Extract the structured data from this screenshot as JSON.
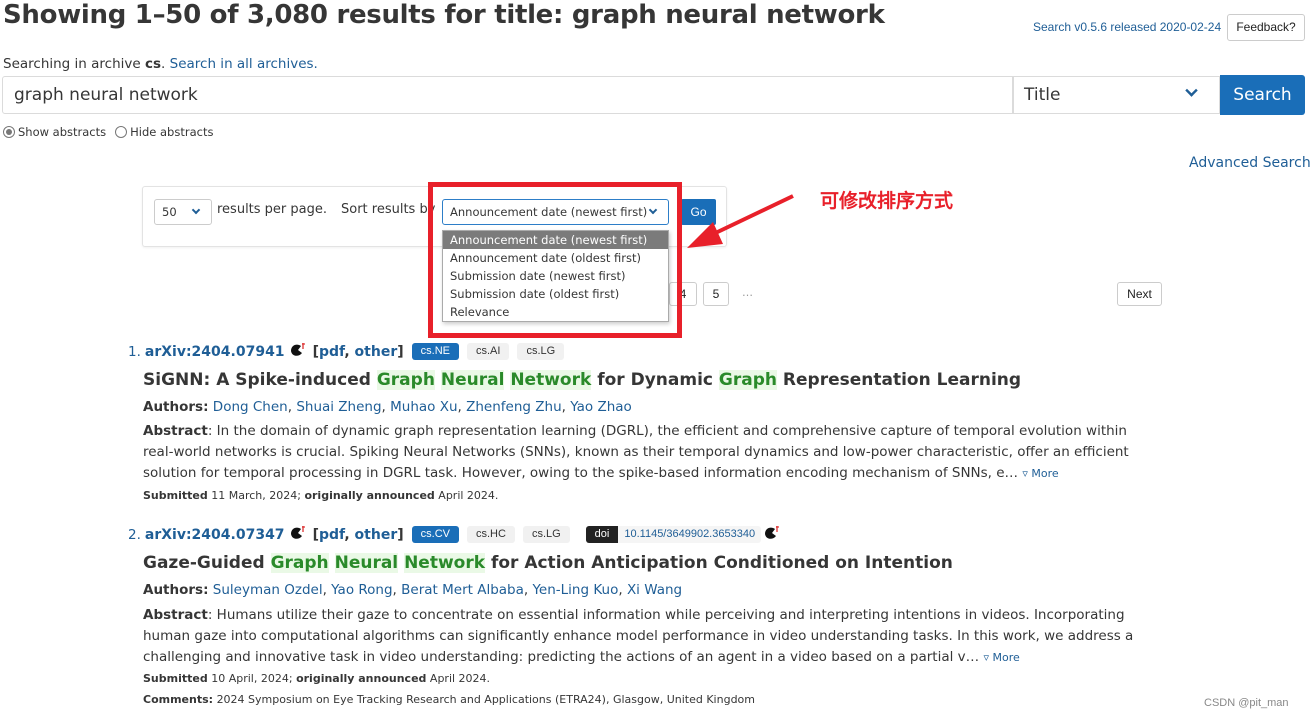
{
  "header": {
    "title": "Showing 1–50 of 3,080 results for title: graph neural network",
    "version_link": "Search v0.5.6 released 2020-02-24",
    "feedback_label": "Feedback?"
  },
  "archive": {
    "prefix": "Searching in archive ",
    "archive_name": "cs",
    "separator": ". ",
    "all_archives_link": "Search in all archives."
  },
  "search": {
    "query": "graph neural network",
    "field": "Title",
    "button_label": "Search",
    "show_abstracts_label": "Show abstracts",
    "hide_abstracts_label": "Hide abstracts",
    "abstracts_mode": "show",
    "advanced_link": "Advanced Search"
  },
  "controls": {
    "per_page_value": "50",
    "per_page_label": "results per page.",
    "sort_label": "Sort results by",
    "sort_value": "Announcement date (newest first)",
    "go_label": "Go",
    "sort_options": [
      "Announcement date (newest first)",
      "Announcement date (oldest first)",
      "Submission date (newest first)",
      "Submission date (oldest first)",
      "Relevance"
    ],
    "sort_selected_index": 0
  },
  "pagination": {
    "visible_pages": [
      "4",
      "5"
    ],
    "ellipsis": "…",
    "next_label": "Next"
  },
  "annotation": {
    "text": "可修改排序方式",
    "color": "#e8202a"
  },
  "results": [
    {
      "number": "1.",
      "id": "arXiv:2404.07941",
      "link_open": "[",
      "pdf": "pdf",
      "comma": ", ",
      "other": "other",
      "link_close": "]",
      "primary_tag": "cs.NE",
      "tags": [
        "cs.AI",
        "cs.LG"
      ],
      "title_parts": [
        {
          "text": "SiGNN: A Spike-induced ",
          "hl": false
        },
        {
          "text": "Graph",
          "hl": true
        },
        {
          "text": " ",
          "hl": false
        },
        {
          "text": "Neural",
          "hl": true
        },
        {
          "text": " ",
          "hl": false
        },
        {
          "text": "Network",
          "hl": true
        },
        {
          "text": " for Dynamic ",
          "hl": false
        },
        {
          "text": "Graph",
          "hl": true
        },
        {
          "text": " Representation Learning",
          "hl": false
        }
      ],
      "authors_label": "Authors:",
      "authors": [
        "Dong Chen",
        "Shuai Zheng",
        "Muhao Xu",
        "Zhenfeng Zhu",
        "Yao Zhao"
      ],
      "abstract_label": "Abstract",
      "abstract": "In the domain of dynamic graph representation learning (DGRL), the efficient and comprehensive capture of temporal evolution within real-world networks is crucial. Spiking Neural Networks (SNNs), known as their temporal dynamics and low-power characteristic, offer an efficient solution for temporal processing in DGRL task. However, owing to the spike-based information encoding mechanism of SNNs, e…",
      "more_label": "▿ More",
      "submitted_label": "Submitted",
      "submitted_date": "11 March, 2024;",
      "announced_label": "originally announced",
      "announced_date": "April 2024."
    },
    {
      "number": "2.",
      "id": "arXiv:2404.07347",
      "link_open": "[",
      "pdf": "pdf",
      "comma": ", ",
      "other": "other",
      "link_close": "]",
      "primary_tag": "cs.CV",
      "tags": [
        "cs.HC",
        "cs.LG"
      ],
      "doi_label": "doi",
      "doi": "10.1145/3649902.3653340",
      "title_parts": [
        {
          "text": "Gaze-Guided ",
          "hl": false
        },
        {
          "text": "Graph",
          "hl": true
        },
        {
          "text": " ",
          "hl": false
        },
        {
          "text": "Neural",
          "hl": true
        },
        {
          "text": " ",
          "hl": false
        },
        {
          "text": "Network",
          "hl": true
        },
        {
          "text": " for Action Anticipation Conditioned on Intention",
          "hl": false
        }
      ],
      "authors_label": "Authors:",
      "authors": [
        "Suleyman Ozdel",
        "Yao Rong",
        "Berat Mert Albaba",
        "Yen-Ling Kuo",
        "Xi Wang"
      ],
      "abstract_label": "Abstract",
      "abstract": "Humans utilize their gaze to concentrate on essential information while perceiving and interpreting intentions in videos. Incorporating human gaze into computational algorithms can significantly enhance model performance in video understanding tasks. In this work, we address a challenging and innovative task in video understanding: predicting the actions of an agent in a video based on a partial v…",
      "more_label": "▿ More",
      "submitted_label": "Submitted",
      "submitted_date": "10 April, 2024;",
      "announced_label": "originally announced",
      "announced_date": "April 2024.",
      "comments_label": "Comments:",
      "comments": "2024 Symposium on Eye Tracking Research and Applications (ETRA24), Glasgow, United Kingdom"
    }
  ],
  "watermark": "CSDN @pit_man"
}
